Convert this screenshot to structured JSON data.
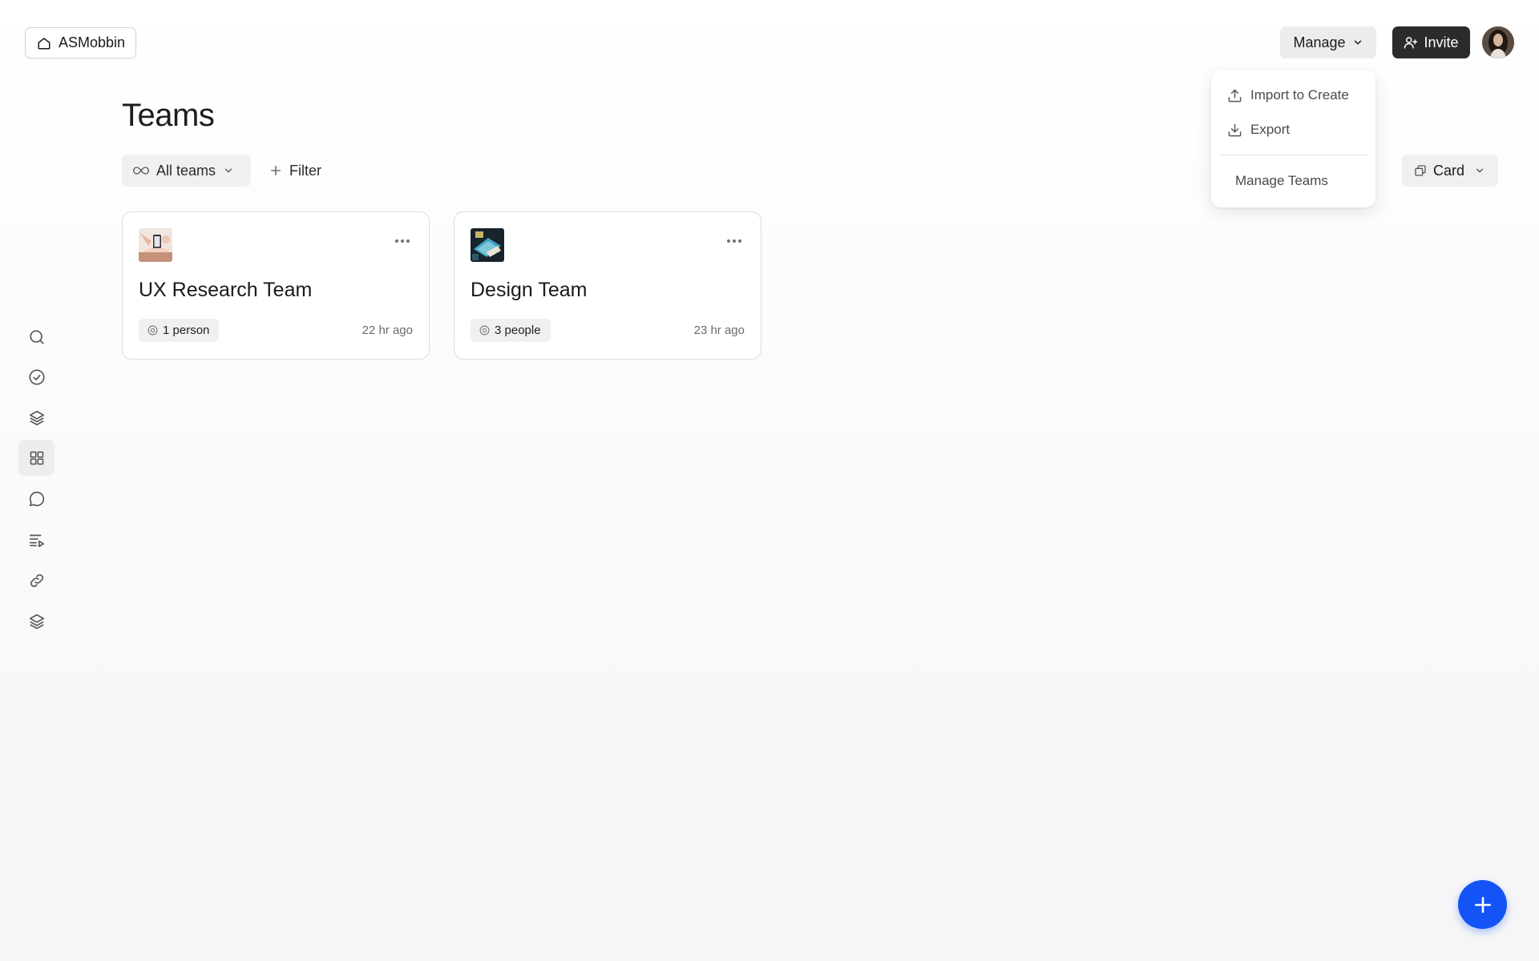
{
  "workspace": {
    "name": "ASMobbin",
    "icon": "home-icon"
  },
  "header": {
    "manage_label": "Manage",
    "invite_label": "Invite",
    "avatar_icon": "user-avatar"
  },
  "manage_menu": {
    "items": [
      {
        "label": "Import to Create",
        "icon": "upload-icon"
      },
      {
        "label": "Export",
        "icon": "download-icon"
      }
    ],
    "manage_teams_label": "Manage Teams"
  },
  "page": {
    "title": "Teams",
    "scope_filter_label": "All teams",
    "filter_label": "Filter",
    "view_label": "Card"
  },
  "teams": [
    {
      "name": "UX Research Team",
      "members": "1 person",
      "updated": "22 hr ago"
    },
    {
      "name": "Design Team",
      "members": "3 people",
      "updated": "23 hr ago"
    }
  ],
  "sidebar": {
    "items": [
      {
        "icon": "search-icon"
      },
      {
        "icon": "check-circle-icon"
      },
      {
        "icon": "layers-icon"
      },
      {
        "icon": "grid-icon",
        "active": true
      },
      {
        "icon": "chat-icon"
      },
      {
        "icon": "playlist-icon"
      },
      {
        "icon": "link-icon"
      },
      {
        "icon": "stack-icon"
      }
    ]
  },
  "colors": {
    "accent": "#1453f5",
    "invite_bg": "#2b2b2b",
    "chip_bg": "#f0f0f1"
  }
}
